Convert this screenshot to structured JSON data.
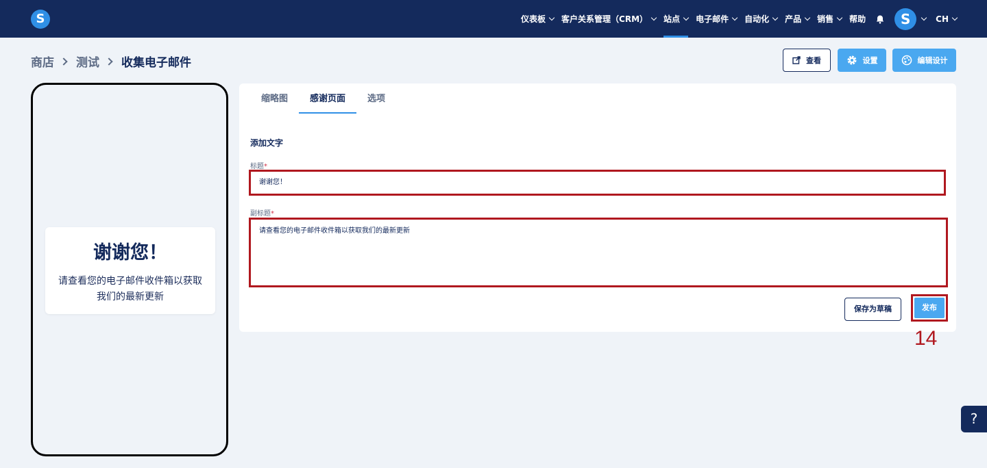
{
  "nav": {
    "items": [
      {
        "label": "仪表板",
        "dropdown": true
      },
      {
        "label": "客户关系管理（CRM）",
        "dropdown": true
      },
      {
        "label": "站点",
        "dropdown": true,
        "active": true
      },
      {
        "label": "电子邮件",
        "dropdown": true
      },
      {
        "label": "自动化",
        "dropdown": true
      },
      {
        "label": "产品",
        "dropdown": true
      },
      {
        "label": "销售",
        "dropdown": true
      },
      {
        "label": "帮助",
        "dropdown": false
      }
    ],
    "logo_letter": "S",
    "avatar_letter": "S",
    "user_initials": "CH"
  },
  "breadcrumb": {
    "items": [
      "商店",
      "测试"
    ],
    "current": "收集电子邮件"
  },
  "header_buttons": {
    "view": "查看",
    "settings": "设置",
    "edit_design": "编辑设计"
  },
  "preview": {
    "title": "谢谢您！",
    "subtitle": "请查看您的电子邮件收件箱以获取我们的最新更新"
  },
  "tabs": [
    {
      "label": "缩略图",
      "active": false
    },
    {
      "label": "感谢页面",
      "active": true
    },
    {
      "label": "选项",
      "active": false
    }
  ],
  "form": {
    "section_title": "添加文字",
    "title_label": "标题",
    "title_value": "谢谢您！",
    "subtitle_label": "副标题",
    "subtitle_value": "请查看您的电子邮件收件箱以获取我们的最新更新",
    "required_mark": "*"
  },
  "actions": {
    "save_draft": "保存为草稿",
    "publish": "发布"
  },
  "step_number": "14",
  "help_label": "?",
  "colors": {
    "nav_bg": "#142a5c",
    "accent": "#4aa8f0",
    "highlight": "#b0181f"
  }
}
